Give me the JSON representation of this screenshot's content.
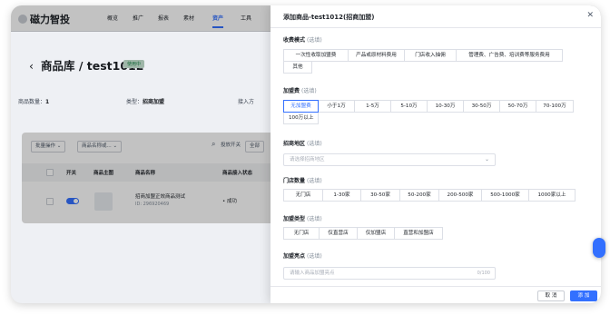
{
  "background": {
    "logo": "磁力智投",
    "nav": [
      "概览",
      "推广",
      "报表",
      "素材",
      "资产",
      "工具"
    ],
    "nav_active": "资产",
    "page_title": "商品库 / test1012",
    "badge": "使用中",
    "meta": {
      "count_label": "商品数量：",
      "count_value": "1",
      "type_label": "类型：",
      "type_value": "招商加盟",
      "access_label": "接入方"
    },
    "toolbar": {
      "batch": "批量操作",
      "name_filter": "商品名称或...",
      "switch_label": "投放开关",
      "switch_placeholder": "全部"
    },
    "table": {
      "headers": [
        "开关",
        "商品主图",
        "商品名称",
        "商品接入状态"
      ],
      "row": {
        "name": "招商加盟正效商品测试",
        "id": "ID: 296920469",
        "status": "• 成功"
      }
    }
  },
  "drawer": {
    "title": "添加商品-test1012(招商加盟)",
    "optional": "(选填)",
    "sections": {
      "fee_mode": {
        "label": "收费模式",
        "options": [
          "一次性收取加盟费",
          "产品或原材料费用",
          "门店收入抽佣",
          "管理费、广告费、培训费等服务费用",
          "其他"
        ]
      },
      "join_fee": {
        "label": "加盟费",
        "options": [
          "无加盟费",
          "小于1万",
          "1-5万",
          "5-10万",
          "10-30万",
          "30-50万",
          "50-70万",
          "70-100万",
          "100万以上"
        ]
      },
      "region": {
        "label": "招商地区",
        "placeholder": "请选择招商地区"
      },
      "stores": {
        "label": "门店数量",
        "options": [
          "无门店",
          "1-30家",
          "30-50家",
          "50-200家",
          "200-500家",
          "500-1000家",
          "1000家以上"
        ]
      },
      "join_type": {
        "label": "加盟类型",
        "options": [
          "无门店",
          "仅直营店",
          "仅加盟店",
          "直营和加盟店"
        ]
      },
      "highlight": {
        "label": "加盟亮点",
        "placeholder": "请输入商品加盟亮点",
        "counter": "0/100"
      }
    },
    "cancel": "取 消",
    "add": "添 加"
  },
  "colors": {
    "accent": "#3370ff",
    "selected_border": "#3370ff",
    "badge_bg": "#d1f0dd"
  }
}
